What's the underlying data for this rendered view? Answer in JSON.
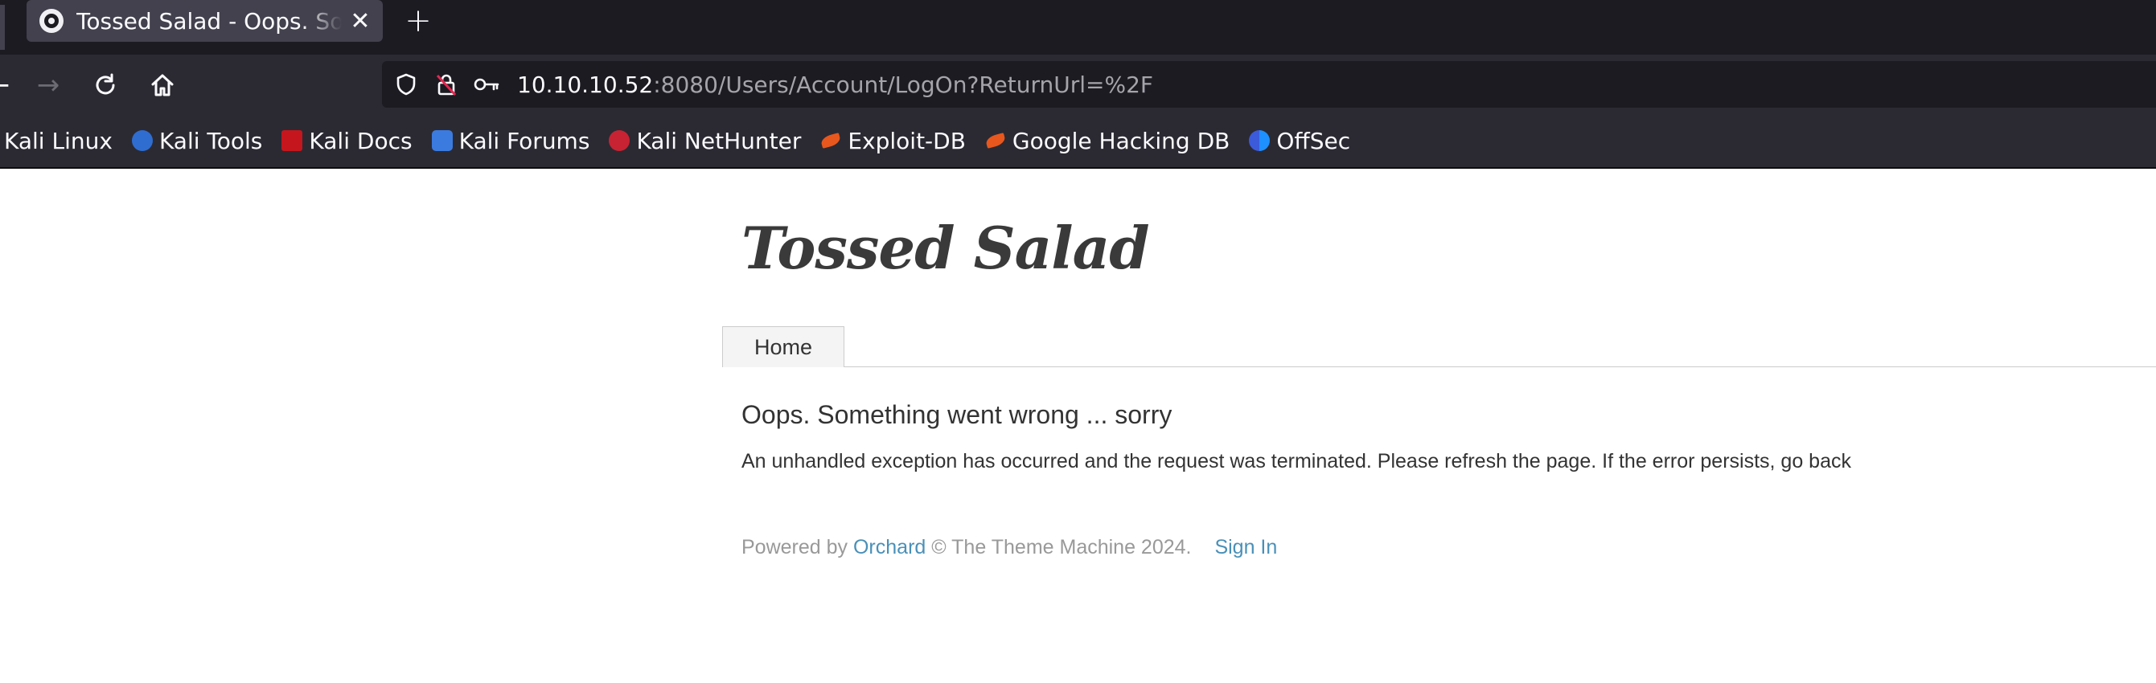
{
  "browser": {
    "tab": {
      "title": "Tossed Salad - Oops. Something went wrong ... sorry",
      "close": "✕"
    },
    "new_tab": "+",
    "nav": {
      "back": "←",
      "forward": "→",
      "reload": "↻",
      "home": "⌂"
    },
    "url": {
      "host": "10.10.10.52",
      "rest": ":8080/Users/Account/LogOn?ReturnUrl=%2F"
    },
    "icons": {
      "tab_favicon": "orchard-icon",
      "shield": "shield-icon",
      "lock": "insecure-lock-icon",
      "key": "key-icon"
    }
  },
  "bookmarks": [
    {
      "label": "Kali Linux",
      "icon": "kali-linux-icon"
    },
    {
      "label": "Kali Tools",
      "icon": "kali-tools-icon"
    },
    {
      "label": "Kali Docs",
      "icon": "kali-docs-icon"
    },
    {
      "label": "Kali Forums",
      "icon": "kali-forums-icon"
    },
    {
      "label": "Kali NetHunter",
      "icon": "kali-nethunter-icon"
    },
    {
      "label": "Exploit-DB",
      "icon": "exploit-db-icon"
    },
    {
      "label": "Google Hacking DB",
      "icon": "google-hacking-db-icon"
    },
    {
      "label": "OffSec",
      "icon": "offsec-icon"
    }
  ],
  "site": {
    "title": "Tossed Salad",
    "menu": [
      "Home"
    ]
  },
  "error": {
    "title": "Oops. Something went wrong ... sorry",
    "text": "An unhandled exception has occurred and the request was terminated. Please refresh the page. If the error persists, go back"
  },
  "footer": {
    "powered_by": "Powered by",
    "orchard": "Orchard",
    "copyright": "© The Theme Machine 2024.",
    "sign_in": "Sign In"
  },
  "colors": {
    "tab_strip": "#1c1b22",
    "toolbar": "#2b2a33",
    "link": "#4a90b8",
    "text": "#333333",
    "muted": "#999999"
  }
}
